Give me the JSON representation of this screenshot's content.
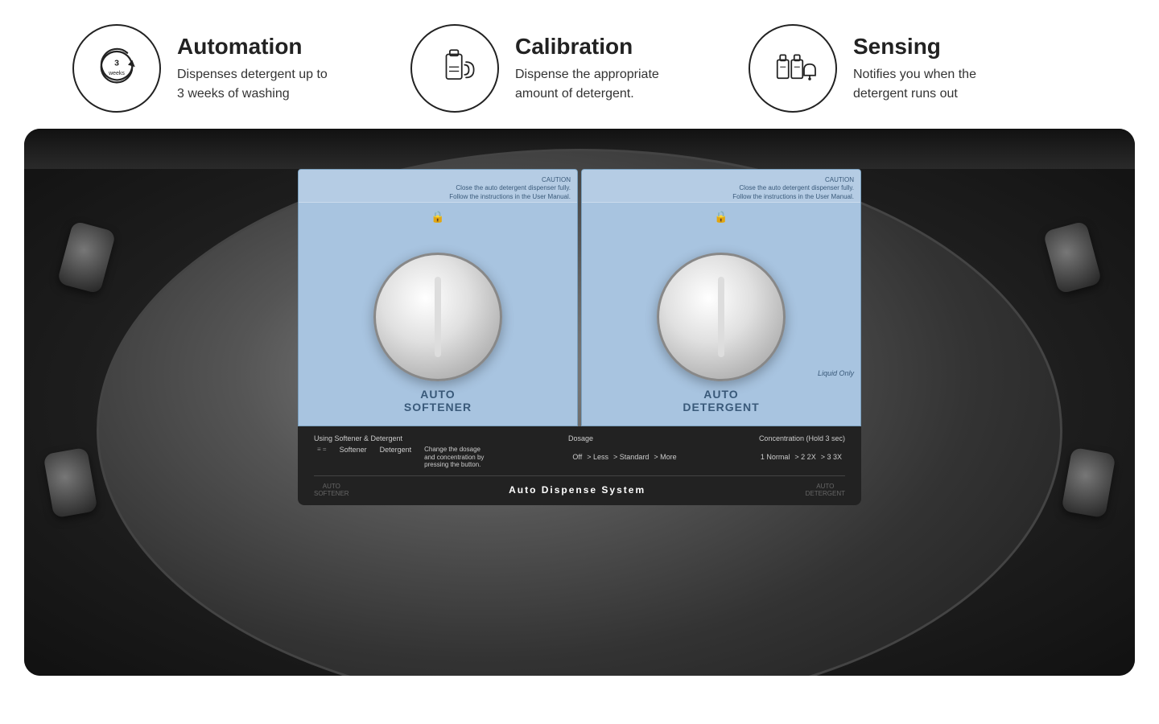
{
  "features": [
    {
      "id": "automation",
      "title": "Automation",
      "desc_line1": "Dispenses detergent up to",
      "desc_line2": "3 weeks of washing",
      "icon": "automation"
    },
    {
      "id": "calibration",
      "title": "Calibration",
      "desc_line1": "Dispense the appropriate",
      "desc_line2": "amount of detergent.",
      "icon": "calibration"
    },
    {
      "id": "sensing",
      "title": "Sensing",
      "desc_line1": "Notifies you when the",
      "desc_line2": "detergent runs out",
      "icon": "sensing"
    }
  ],
  "dispensers": {
    "left": {
      "label_line1": "AUTO",
      "label_line2": "SOFTENER",
      "caution": "CAUTION",
      "bottom_label": "AUTO\nSOFTENER"
    },
    "right": {
      "label_line1": "AUTO",
      "label_line2": "DETERGENT",
      "liquid_only": "Liquid Only",
      "caution": "CAUTION",
      "bottom_label": "AUTO\nDETERGENT"
    },
    "bottom_title": "Auto Dispense System",
    "bottom_sub": "Using Softener & Detergent",
    "dosage_label": "Dosage",
    "concentration_label": "Concentration (Hold 3 sec)"
  }
}
